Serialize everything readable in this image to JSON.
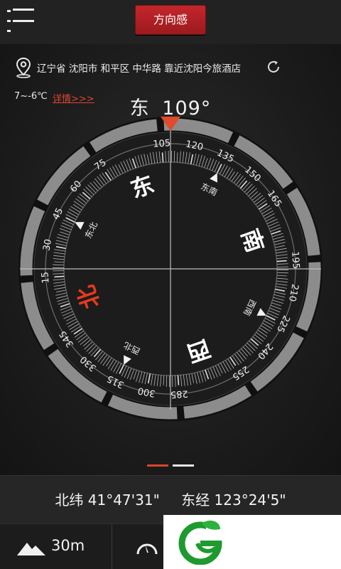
{
  "app": {
    "title": "方向感",
    "menu_icon": "hamburger-menu-icon"
  },
  "location": {
    "text": "辽宁省 沈阳市 和平区 中华路 靠近沈阳今旅酒店",
    "pin_icon": "location-pin-icon",
    "refresh_icon": "refresh-icon"
  },
  "weather": {
    "temperature": "7~-6℃",
    "detail_link": "详情>>>"
  },
  "heading": {
    "direction": "东",
    "degrees": "109°",
    "degrees_value": 109
  },
  "compass": {
    "tick_labels": [
      "105",
      "120",
      "135",
      "150",
      "165",
      "195",
      "210",
      "225",
      "240",
      "255",
      "285",
      "300",
      "315",
      "330",
      "345",
      "15",
      "30",
      "45",
      "60",
      "75"
    ],
    "cardinals": [
      {
        "label": "东",
        "angle": 90
      },
      {
        "label": "南",
        "angle": 180
      },
      {
        "label": "西",
        "angle": 270
      },
      {
        "label": "北",
        "angle": 0,
        "color": "#e8391e"
      }
    ],
    "intercardinals": [
      {
        "label": "东北",
        "angle": 45
      },
      {
        "label": "东南",
        "angle": 135
      },
      {
        "label": "西南",
        "angle": 225
      },
      {
        "label": "西北",
        "angle": 315
      }
    ],
    "accent_color": "#e04b2c"
  },
  "pager": {
    "pages": 2,
    "current": 0
  },
  "coordinates": {
    "latitude": "北纬 41°47'31\"",
    "longitude": "东经 123°24'5\""
  },
  "altitude": {
    "value": "30m",
    "icon": "mountain-icon"
  },
  "speed": {
    "icon": "speedometer-icon"
  },
  "ad": {
    "logo": "green-leaf-logo"
  }
}
